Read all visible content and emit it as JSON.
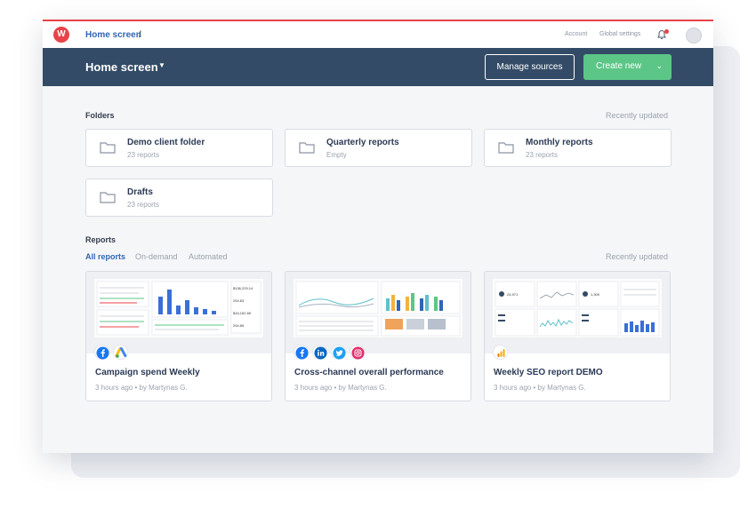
{
  "topbar": {
    "logo_letter": "W",
    "breadcrumb": "Home screen",
    "breadcrumb_sep": "/",
    "account": "Account",
    "global_settings": "Global settings"
  },
  "header": {
    "title": "Home screen",
    "manage_sources": "Manage sources",
    "create_new": "Create new"
  },
  "folders_section": {
    "title": "Folders",
    "sort": "Recently updated",
    "items": [
      {
        "name": "Demo client folder",
        "sub": "23 reports"
      },
      {
        "name": "Quarterly reports",
        "sub": "Empty"
      },
      {
        "name": "Monthly reports",
        "sub": "23 reports"
      },
      {
        "name": "Drafts",
        "sub": "23 reports"
      }
    ]
  },
  "reports_section": {
    "title": "Reports",
    "sort": "Recently updated",
    "tabs": [
      "All reports",
      "On-demand",
      "Automated"
    ],
    "active_tab": "All reports",
    "items": [
      {
        "name": "Campaign spend Weekly",
        "meta": "3 hours ago  •  by Martynas G.",
        "sources": [
          "facebook-icon",
          "google-ads-icon"
        ]
      },
      {
        "name": "Cross-channel overall performance",
        "meta": "3 hours ago  •  by Martynas G.",
        "sources": [
          "facebook-icon",
          "linkedin-icon",
          "twitter-icon",
          "instagram-icon"
        ]
      },
      {
        "name": "Weekly SEO report DEMO",
        "meta": "3 hours ago  •  by Martynas G.",
        "sources": [
          "google-analytics-icon"
        ]
      }
    ]
  },
  "colors": {
    "accent": "#e8434a",
    "header": "#334b66",
    "create_button": "#5cc687",
    "link": "#2f66b5"
  }
}
